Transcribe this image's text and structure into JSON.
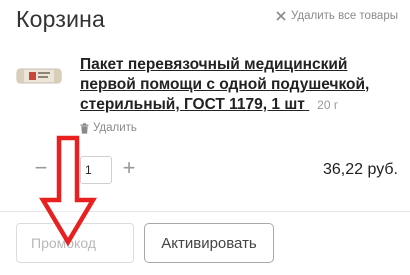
{
  "cart": {
    "title": "Корзина",
    "clear_all_label": "Удалить все товары",
    "clear_icon": "close-icon"
  },
  "item": {
    "name": "Пакет перевязочный медицинский первой помощи с одной подушечкой, стерильный, ГОСТ 1179, 1 шт",
    "weight": "20 г",
    "remove_label": "Удалить",
    "remove_icon": "trash-icon",
    "quantity": "1",
    "minus_symbol": "−",
    "plus_symbol": "+",
    "price": "36,22 руб."
  },
  "promo": {
    "placeholder": "Промокод",
    "button_label": "Активировать"
  },
  "colors": {
    "arrow": "#e8201f",
    "muted_text": "#8a8a8a",
    "border": "#cfcfcf"
  }
}
